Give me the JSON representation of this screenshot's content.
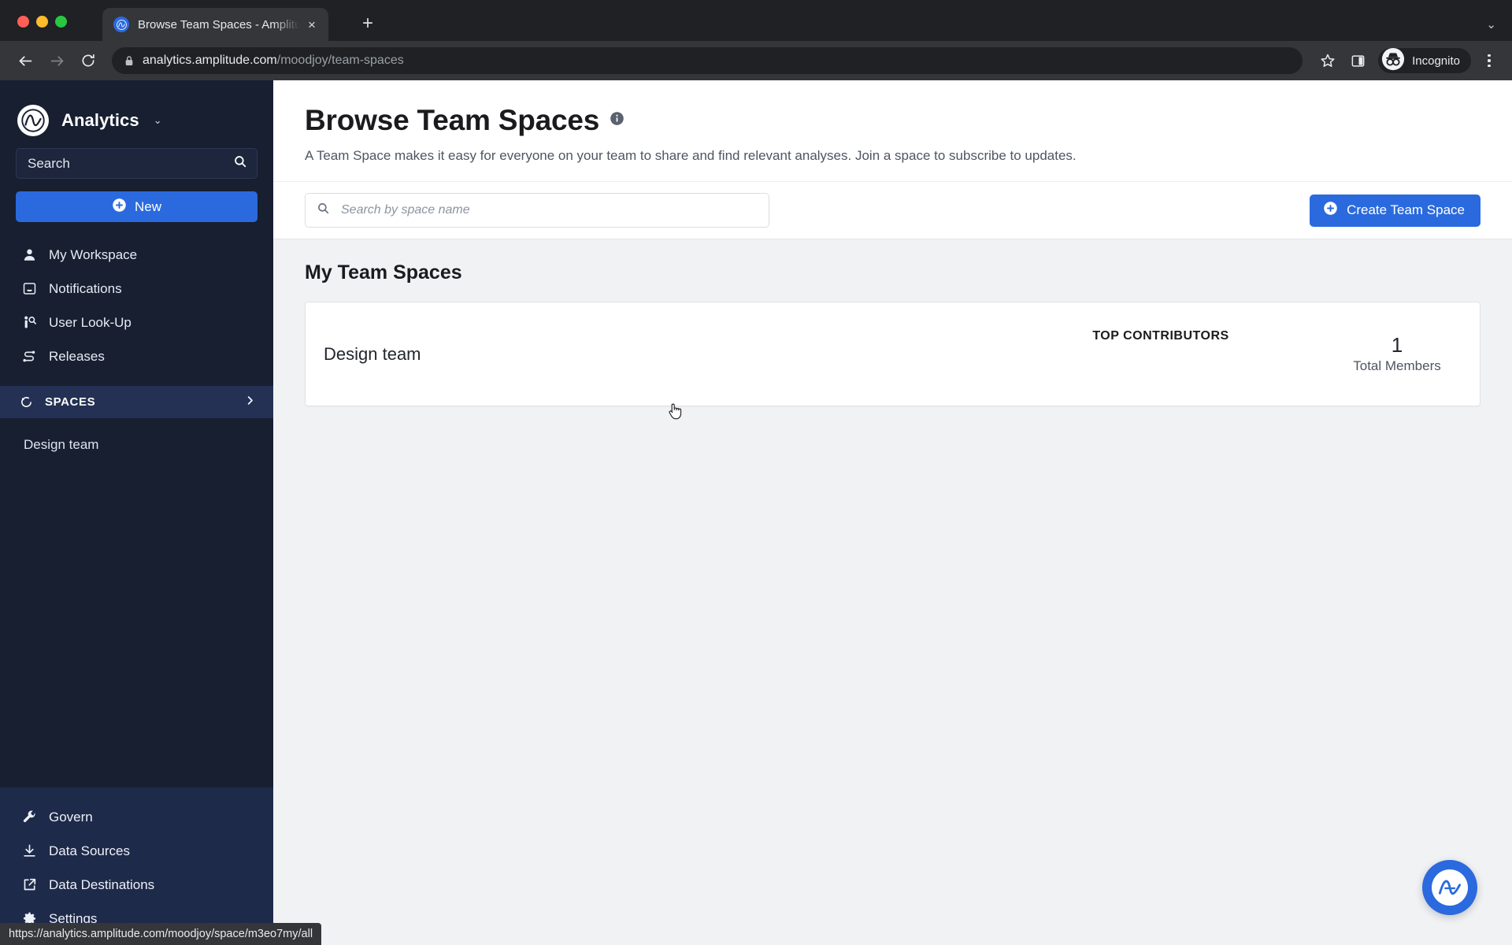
{
  "browser": {
    "tab": {
      "title": "Browse Team Spaces - Amplitu",
      "favicon": "amplitude-logo-icon",
      "close": "×"
    },
    "new_tab": "+",
    "tabstrip_expand": "⌄",
    "omnibox": {
      "domain": "analytics.amplitude.com",
      "path": "/moodjoy/team-spaces",
      "lock": "lock-icon"
    },
    "profile": {
      "label": "Incognito"
    },
    "status_bar_url": "https://analytics.amplitude.com/moodjoy/space/m3eo7my/all"
  },
  "sidebar": {
    "brand": {
      "name": "Analytics",
      "caret": "⌄"
    },
    "search": {
      "placeholder": "Search",
      "icon": "search-icon"
    },
    "new_button": {
      "label": "New",
      "icon": "plus-circle-icon"
    },
    "nav_items": [
      {
        "label": "My Workspace",
        "icon": "person-icon"
      },
      {
        "label": "Notifications",
        "icon": "inbox-icon"
      },
      {
        "label": "User Look-Up",
        "icon": "person-search-icon"
      },
      {
        "label": "Releases",
        "icon": "releases-icon"
      }
    ],
    "spaces": {
      "label": "SPACES",
      "icon": "spaces-icon",
      "chevron": "›",
      "items": [
        {
          "label": "Design team"
        }
      ]
    },
    "bottom_items": [
      {
        "label": "Govern",
        "icon": "wrench-icon"
      },
      {
        "label": "Data Sources",
        "icon": "download-icon"
      },
      {
        "label": "Data Destinations",
        "icon": "export-icon"
      },
      {
        "label": "Settings",
        "icon": "gear-icon"
      }
    ]
  },
  "page": {
    "title": "Browse Team Spaces",
    "info_icon": "info-icon",
    "subtitle": "A Team Space makes it easy for everyone on your team to share and find relevant analyses. Join a space to subscribe to updates.",
    "search": {
      "placeholder": "Search by space name",
      "icon": "search-icon"
    },
    "create_button": {
      "label": "Create Team Space",
      "icon": "plus-circle-icon"
    },
    "section_title": "My Team Spaces",
    "card": {
      "space_name": "Design team",
      "contributors_label": "TOP CONTRIBUTORS",
      "members_count": "1",
      "members_label": "Total Members"
    },
    "fab": {
      "icon": "amplitude-logo-icon"
    }
  },
  "colors": {
    "accent": "#2a6ade",
    "sidebar_top": "#171f31",
    "sidebar_bottom": "#1e2a4a",
    "spaces_header": "#243154",
    "page_bg": "#f1f2f4"
  }
}
